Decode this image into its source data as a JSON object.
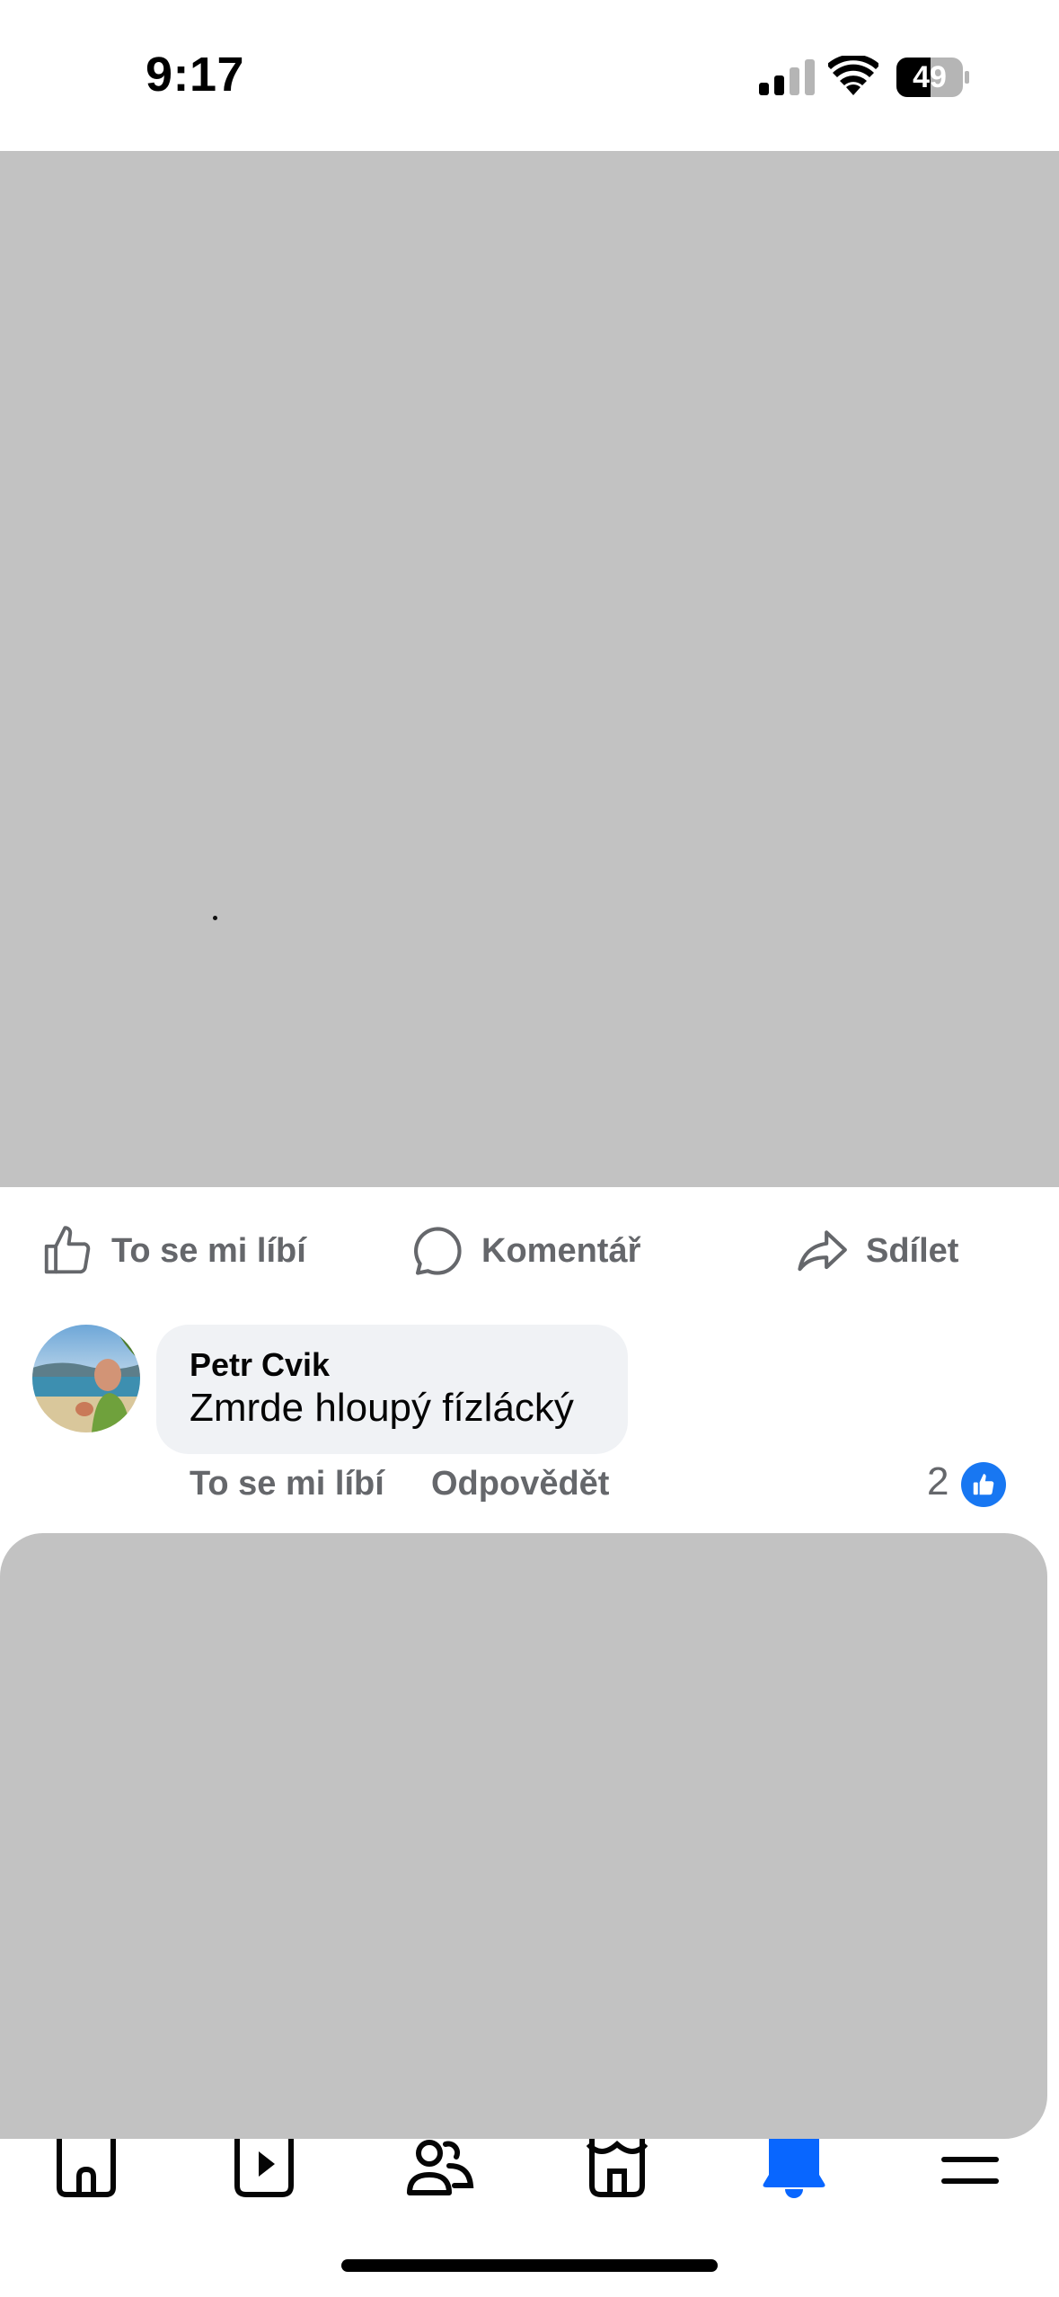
{
  "status_bar": {
    "time": "9:17",
    "battery_level": "49",
    "icons": [
      "signal-icon",
      "wifi-icon",
      "battery-icon"
    ]
  },
  "post": {
    "media_placeholder_color": "#c2c2c2",
    "actions": {
      "like_label": "To se mi líbí",
      "comment_label": "Komentář",
      "share_label": "Sdílet"
    }
  },
  "comment": {
    "author": "Petr Cvik",
    "text": "Zmrde hloupý fízlácký",
    "like_label": "To se mi líbí",
    "reply_label": "Odpovědět",
    "reaction_count": "2",
    "reaction_icon": "thumbs-up-icon",
    "reaction_color": "#1877f2"
  },
  "tab_bar": {
    "tabs": [
      "home-icon",
      "video-icon",
      "friends-icon",
      "marketplace-icon",
      "notifications-icon",
      "menu-icon"
    ],
    "active_tab": "notifications-icon",
    "accent_color": "#0866ff"
  }
}
